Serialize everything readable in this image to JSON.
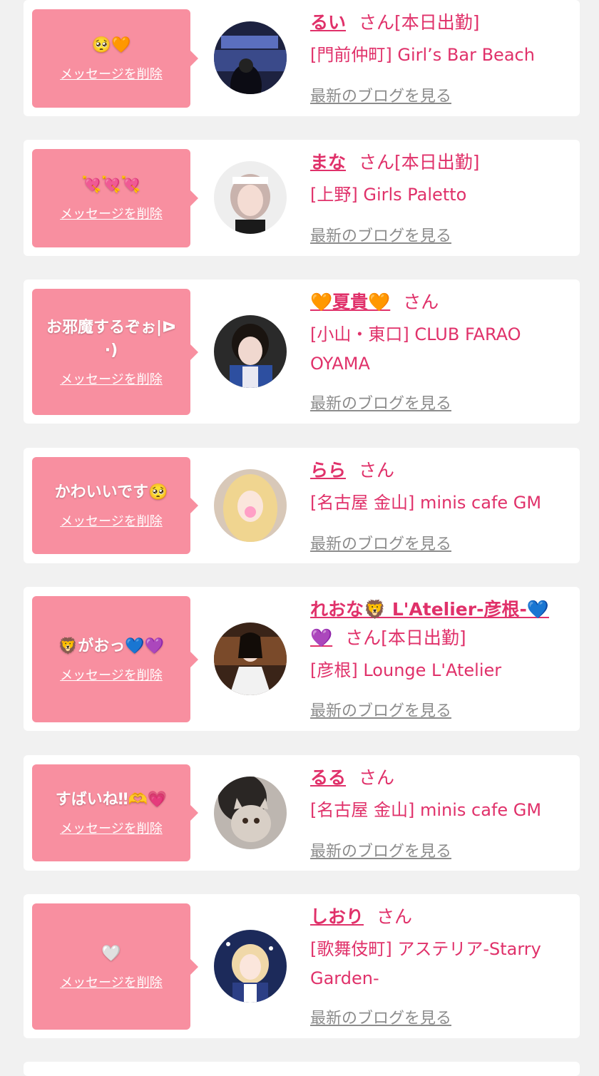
{
  "delete_label": "メッセージを削除",
  "blog_label": "最新のブログを見る",
  "cards": [
    {
      "message": "🥺🧡",
      "name": "るい",
      "suffix": "さん[本日出勤]",
      "shop": "[門前仲町] Girl’s Bar Beach"
    },
    {
      "message": "💘💘💘",
      "name": "まな",
      "suffix": "さん[本日出勤]",
      "shop": "[上野] Girls Paletto"
    },
    {
      "message": "お邪魔するぞぉ|ᐅ·)",
      "name": "🧡夏貴🧡",
      "suffix": "さん",
      "shop": "[小山・東口] CLUB FARAO OYAMA"
    },
    {
      "message": "かわいいです🥺",
      "name": "らら",
      "suffix": "さん",
      "shop": "[名古屋 金山] minis cafe GM"
    },
    {
      "message": "🦁がおっ💙💜",
      "name": "れおな🦁 L'Atelier-彦根-💙",
      "name_line2": "💜",
      "suffix": "さん[本日出勤]",
      "shop": "[彦根] Lounge L'Atelier"
    },
    {
      "message": "すばいね‼🫶💗",
      "name": "るる",
      "suffix": "さん",
      "shop": "[名古屋 金山] minis cafe GM"
    },
    {
      "message": "🤍",
      "name": "しおり",
      "suffix": "さん",
      "shop": "[歌舞伎町] アステリア-Starry Garden-"
    }
  ]
}
